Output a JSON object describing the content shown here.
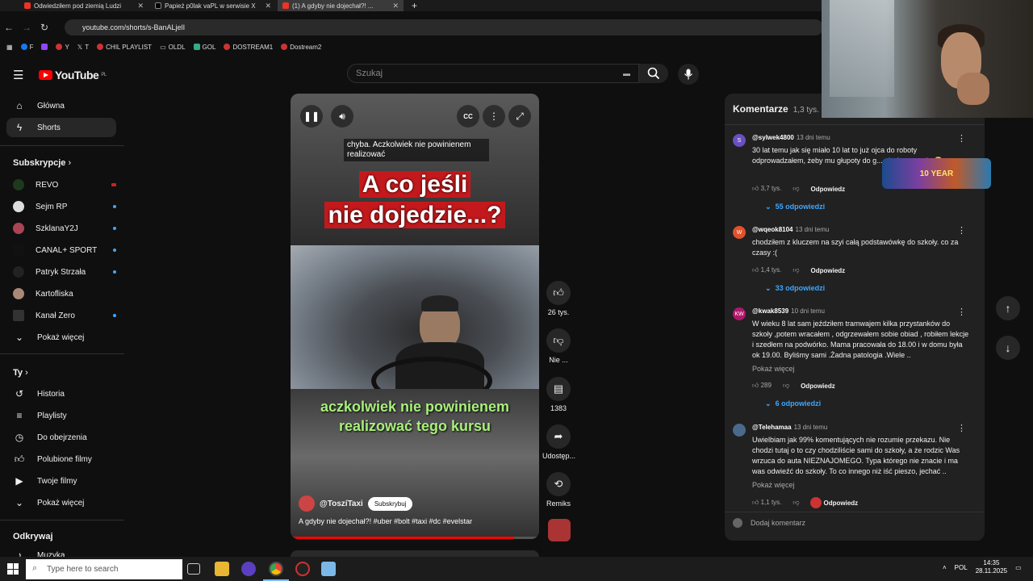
{
  "browser": {
    "tabs": [
      {
        "title": "Odwiedziłem pod ziemią Ludzi"
      },
      {
        "title": "Papież p0lak vaPL w serwisie X"
      },
      {
        "title": "(1) A gdyby nie dojechał?! ..."
      }
    ],
    "url": "youtube.com/shorts/s-BanALjelI",
    "bookmarks": [
      "F",
      "",
      "Y",
      "T",
      "CHIL PLAYLIST",
      "OLDL",
      "GOL",
      "DOSTREAM1",
      "Dostream2"
    ]
  },
  "youtube": {
    "logo_text": "YouTube",
    "region": "PL",
    "search_placeholder": "Szukaj"
  },
  "sidebar": {
    "main": [
      {
        "label": "Główna",
        "icon": "home-icon"
      },
      {
        "label": "Shorts",
        "icon": "shorts-icon"
      }
    ],
    "subs_title": "Subskrypcje",
    "subs": [
      {
        "label": "REVO"
      },
      {
        "label": "Sejm RP"
      },
      {
        "label": "SzklanaY2J"
      },
      {
        "label": "CANAL+ SPORT"
      },
      {
        "label": "Patryk Strzała"
      },
      {
        "label": "Kartofliska"
      },
      {
        "label": "Kanał Zero"
      },
      {
        "label": "Pokaż więcej"
      }
    ],
    "you_title": "Ty",
    "you": [
      {
        "label": "Historia"
      },
      {
        "label": "Playlisty"
      },
      {
        "label": "Do obejrzenia"
      },
      {
        "label": "Polubione filmy"
      },
      {
        "label": "Twoje filmy"
      },
      {
        "label": "Pokaż więcej"
      }
    ],
    "discover_title": "Odkrywaj",
    "discover": [
      {
        "label": "Muzyka"
      }
    ]
  },
  "video": {
    "caption_small": "chyba. Aczkolwiek nie powinienem realizować",
    "title_line1": "A co jeśli",
    "title_line2": "nie dojedzie...?",
    "subtitle": "aczkolwiek nie powinienem realizować tego kursu",
    "channel": "@ToszíTaxi",
    "subscribe_label": "Subskrybuj",
    "description": "A gdyby nie dojechał?! #uber #bolt #taxi #dc #evelstar",
    "progress": 0.9,
    "cc_label": "CC"
  },
  "actions": {
    "likes": "26 tys.",
    "dislike": "Nie ...",
    "comments": "1383",
    "share": "Udostęp...",
    "remix": "Remiks"
  },
  "comments": {
    "title": "Komentarze",
    "count": "1,3 tys.",
    "reply_label": "Odpowiedz",
    "show_more": "Pokaż więcej",
    "add_placeholder": "Dodaj komentarz",
    "items": [
      {
        "avatar": "S",
        "color": "#6a4fc2",
        "author": "@sylwek4800",
        "time": "13 dni temu",
        "text": "30 lat temu jak się miało 10 lat to już ojca do roboty odprowadzałem, żeby mu głupoty do g... nie że on mnie 😂",
        "likes": "3,7 tys.",
        "replies": "55 odpowiedzi"
      },
      {
        "avatar": "W",
        "color": "#e0522b",
        "author": "@wqeok8104",
        "time": "13 dni temu",
        "text": "chodziłem z kluczem na szyi całą podstawówkę do szkoły. co za czasy :(",
        "likes": "1,4 tys.",
        "replies": "33 odpowiedzi"
      },
      {
        "avatar": "KW",
        "color": "#b0176b",
        "author": "@kwak8539",
        "time": "10 dni temu",
        "text": "W wieku 8 lat sam jeździłem tramwajem kilka przystanków do szkoły ,potem wracałem , odgrzewałem sobie obiad , robiłem lekcje i szedłem na podwórko. Mama pracowała do 18.00 i w domu była ok 19.00. Byliśmy sami .Żadna patologia .Wiele ..",
        "likes": "289",
        "replies": "6 odpowiedzi"
      },
      {
        "avatar": "",
        "color": "#4a6a8a",
        "author": "@Telehamaa",
        "time": "13 dni temu",
        "text": "Uwielbiam jak 99% komentujących nie rozumie przekazu. Nie chodzi tutaj o to czy chodziliście sami do szkoły, a że rodzic Was wrzuca do auta NIEZNAJOMEGO. Typa którego nie znacie i ma was odwieźć do szkoły. To co innego niż iść pieszo, jechać ..",
        "likes": "1,1 tys.",
        "replies": ""
      }
    ]
  },
  "stream_banner": "10 YEAR",
  "taskbar": {
    "search_placeholder": "Type here to search",
    "lang": "POL",
    "time": "14:35",
    "date": "28.11.2025"
  }
}
